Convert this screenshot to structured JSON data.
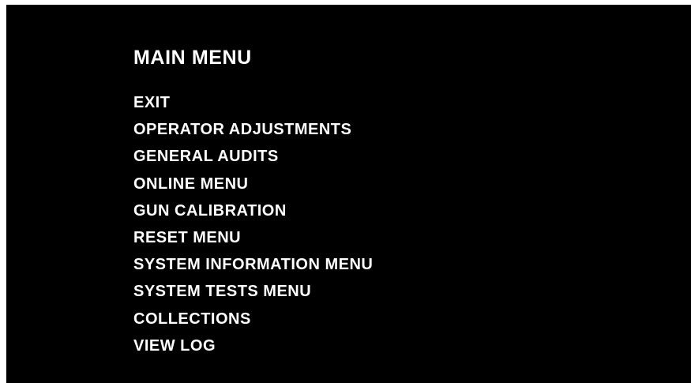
{
  "menu": {
    "title": "MAIN MENU",
    "items": [
      "EXIT",
      "OPERATOR ADJUSTMENTS",
      "GENERAL AUDITS",
      "ONLINE MENU",
      "GUN CALIBRATION",
      "RESET MENU",
      "SYSTEM INFORMATION MENU",
      "SYSTEM TESTS MENU",
      "COLLECTIONS",
      "VIEW LOG"
    ]
  },
  "colors": {
    "background": "#000000",
    "text": "#ffffff"
  }
}
